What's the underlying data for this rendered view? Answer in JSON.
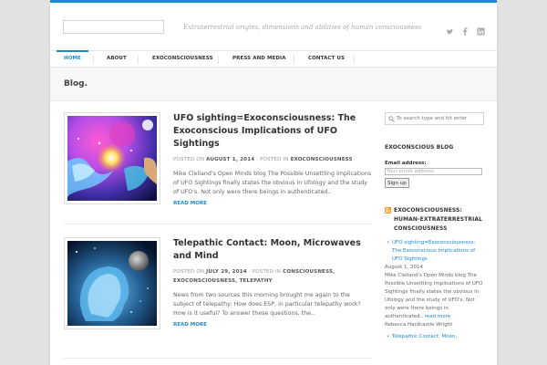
{
  "header": {
    "tagline": "Extraterrestrial origins, dimensions and abilities of human consciousness",
    "social_icons": [
      "twitter-icon",
      "facebook-icon",
      "linkedin-icon"
    ]
  },
  "nav": {
    "items": [
      {
        "label": "HOME",
        "active": true
      },
      {
        "label": "ABOUT"
      },
      {
        "label": "EXOCONSCIOUSNESS"
      },
      {
        "label": "PRESS AND MEDIA"
      },
      {
        "label": "CONTACT US"
      }
    ]
  },
  "page_title": "Blog.",
  "posts": [
    {
      "title": "UFO sighting=Exoconsciousness: The Exoconscious Implications of UFO Sightings",
      "posted_on_label": "POSTED ON",
      "date": "AUGUST 1, 2014",
      "posted_in_label": "· POSTED IN",
      "categories": "EXOCONSCIOUSNESS",
      "excerpt": "Mike Clelland's Open Minds blog The Possible Unsettling Implications of UFO Sightings finally states the obvious in Ufology and the study of UFO's.  Not only were there beings in authenticated..",
      "read_more": "READ MORE"
    },
    {
      "title": "Telepathic Contact: Moon, Microwaves and Mind",
      "posted_on_label": "POSTED ON",
      "date": "JULY 29, 2014",
      "posted_in_label": "· POSTED IN",
      "categories": "CONSCIOUSNESS, EXOCONSCIOUSNESS, TELEPATHY",
      "excerpt": "News from two sources this morning brought me again to the subject of telepathy: How does ESP, in particular telepathy work? How is it useful? To answer these questions, the..",
      "read_more": "READ MORE"
    }
  ],
  "sidebar": {
    "search_placeholder": "To search type and hit enter",
    "blog_widget_title": "EXOCONSCIOUS BLOG",
    "email_label": "Email address:",
    "email_placeholder": "Your email address",
    "signup_label": "Sign up",
    "rss_title": "EXOCONSCIOUSNESS: HUMAN-EXTRATERRESTRIAL CONSCIOUSNESS",
    "rss_items": [
      {
        "title": "UFO sighting=Exoconsciousness: The Exoconscious Implications of UFO Sightings",
        "date": "August 1, 2014",
        "desc": "Mike Clelland's Open Minds blog The Possible Unsettling Implications of UFO Sightings finally states the obvious in Ufology and the study of UFO's.  Not only were there beings in authenticated.. ",
        "more": "read more",
        "author": "Rebecca Hardcastle Wright"
      },
      {
        "title": "Telepathic Contact: Moon,"
      }
    ]
  },
  "colors": {
    "accent": "#1a8ad2",
    "rss": "#f59a25"
  }
}
